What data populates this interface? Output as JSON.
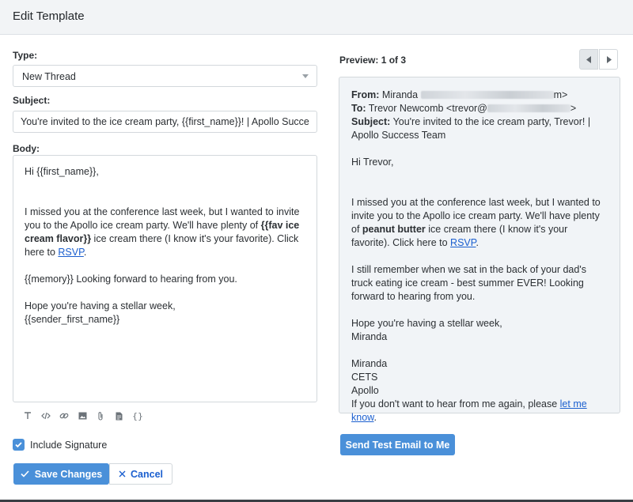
{
  "header": {
    "title": "Edit Template"
  },
  "form": {
    "type_label": "Type:",
    "type_value": "New Thread",
    "subject_label": "Subject:",
    "subject_value": "You're invited to the ice cream party, {{first_name}}! | Apollo Success",
    "body_label": "Body:",
    "body": {
      "greeting": "Hi {{first_name}},",
      "p1_a": "I missed you at the conference last week, but I wanted to invite you to the Apollo ice cream party. We'll have plenty of ",
      "p1_bold": "{{fav ice cream flavor}}",
      "p1_b": " ice cream there (I know it's your favorite). Click here to ",
      "p1_link": "RSVP",
      "p1_c": ".",
      "p2": "{{memory}} Looking forward to hearing from you.",
      "closing": "Hope you're having a stellar week,",
      "signature_var": "{{sender_first_name}}"
    },
    "toolbar_icons": [
      "text-format-icon",
      "code-icon",
      "link-icon",
      "image-icon",
      "attachment-icon",
      "snippet-icon",
      "variable-icon"
    ],
    "include_signature_label": "Include Signature",
    "include_signature_checked": true,
    "save_label": "Save Changes",
    "cancel_label": "Cancel"
  },
  "preview": {
    "label": "Preview: 1 of 3",
    "from_label": "From:",
    "from_name": "Miranda",
    "from_end": "m>",
    "to_label": "To:",
    "to_value": "Trevor Newcomb <trevor@",
    "to_end": ">",
    "subject_label": "Subject:",
    "subject_value": "You're invited to the ice cream party, Trevor! | Apollo Success Team",
    "greeting": "Hi Trevor,",
    "p1_a": "I missed you at the conference last week, but I wanted to invite you to the Apollo ice cream party. We'll have plenty of ",
    "p1_bold": "peanut butter",
    "p1_b": " ice cream there (I know it's your favorite). Click here to ",
    "p1_link": "RSVP",
    "p1_c": ".",
    "p2": "I still remember when we sat in the back of your dad's truck eating ice cream - best summer EVER! Looking forward to hearing from you.",
    "closing": "Hope you're having a stellar week,",
    "closing_name": "Miranda",
    "sig_name": "Miranda",
    "sig_title": "CETS",
    "sig_company": "Apollo",
    "unsubscribe_a": "If you don't want to hear from me again, please ",
    "unsubscribe_link": "let me know",
    "unsubscribe_c": ".",
    "send_test_label": "Send Test Email to Me"
  },
  "colors": {
    "accent": "#4a90d9",
    "link": "#1b5fcf"
  }
}
